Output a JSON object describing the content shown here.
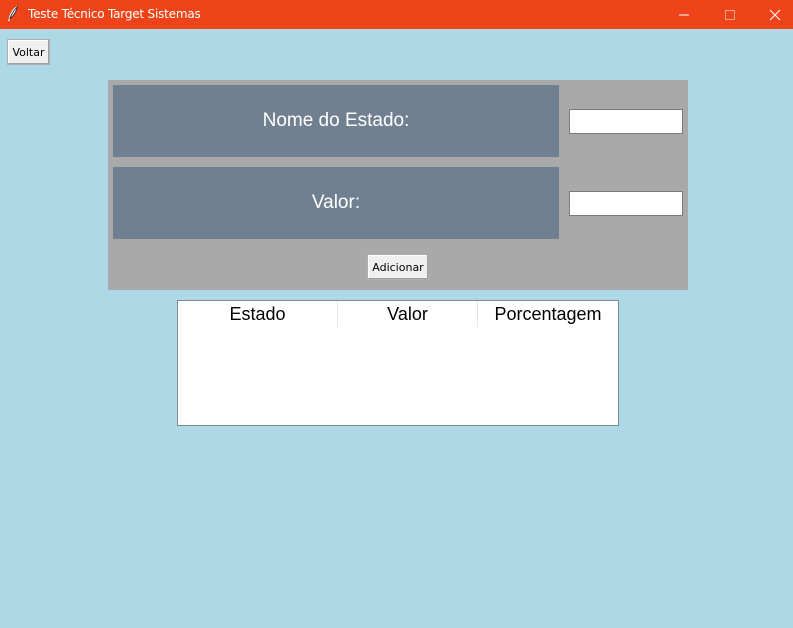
{
  "window": {
    "title": "Teste Técnico Target Sistemas",
    "title_bar_color": "#ef4419",
    "icon": "feather-icon",
    "controls": [
      "minimize-icon",
      "maximize-icon",
      "close-icon"
    ]
  },
  "toolbar": {
    "back_label": "Voltar"
  },
  "form": {
    "state_label": "Nome do Estado:",
    "state_value": "",
    "value_label": "Valor:",
    "value_value": "",
    "add_label": "Adicionar",
    "panel_color": "#a9a9a9",
    "label_color": "#708090"
  },
  "table": {
    "columns": [
      "Estado",
      "Valor",
      "Porcentagem"
    ],
    "rows": []
  },
  "background_color": "#add8e6"
}
